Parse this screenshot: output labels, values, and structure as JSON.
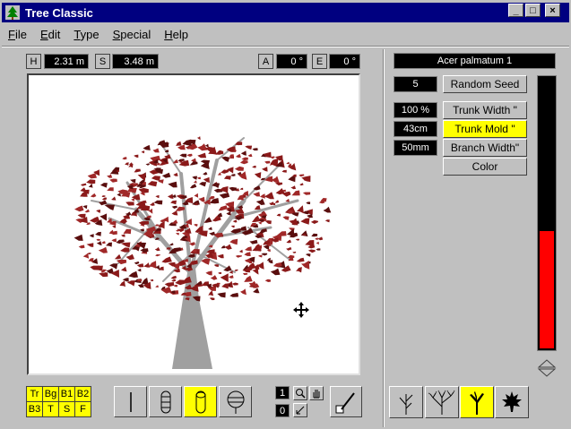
{
  "window": {
    "title": "Tree Classic",
    "controls": [
      "_",
      "□",
      "×"
    ]
  },
  "menu": [
    {
      "label": "File",
      "key": "F",
      "rest": "ile"
    },
    {
      "label": "Edit",
      "key": "E",
      "rest": "dit"
    },
    {
      "label": "Type",
      "key": "T",
      "rest": "ype"
    },
    {
      "label": "Special",
      "key": "S",
      "rest": "pecial"
    },
    {
      "label": "Help",
      "key": "H",
      "rest": "elp"
    }
  ],
  "dimensions": {
    "height_label": "H",
    "height_value": "2.31 m",
    "spread_label": "S",
    "spread_value": "3.48 m",
    "angle_label": "A",
    "angle_value": "0 °",
    "elevation_label": "E",
    "elevation_value": "0 °"
  },
  "layers": [
    "Tr",
    "Bg",
    "B1",
    "B2",
    "B3",
    "T",
    "S",
    "F"
  ],
  "render_tools": [
    {
      "name": "line",
      "active": false
    },
    {
      "name": "segments",
      "active": false
    },
    {
      "name": "cylinder",
      "active": true
    },
    {
      "name": "leaves",
      "active": false
    }
  ],
  "view_tools": {
    "counter_top": "1",
    "counter_bottom": "0"
  },
  "species": "Acer palmatum 1",
  "seed": {
    "value": "5",
    "button": "Random Seed"
  },
  "trunk": [
    {
      "value": "100 %",
      "button": "Trunk Width \"",
      "active": false
    },
    {
      "value": "43cm",
      "button": "Trunk Mold \"",
      "active": true
    },
    {
      "value": "50mm",
      "button": "Branch Width\"",
      "active": false
    },
    {
      "value": "",
      "button": "Color",
      "active": false
    }
  ],
  "meter_level_fraction": 0.43,
  "colors": {
    "titlebar": "#000080",
    "highlight": "#ffff00",
    "foliage": "#8b1a1a",
    "trunk": "#a0a0a0",
    "meter": "#ff0000"
  },
  "tree_types": [
    {
      "name": "bare-tree-type",
      "active": false
    },
    {
      "name": "bushy-tree-type",
      "active": false
    },
    {
      "name": "branching-tree-type",
      "active": true
    },
    {
      "name": "leaf-type",
      "active": false
    }
  ]
}
